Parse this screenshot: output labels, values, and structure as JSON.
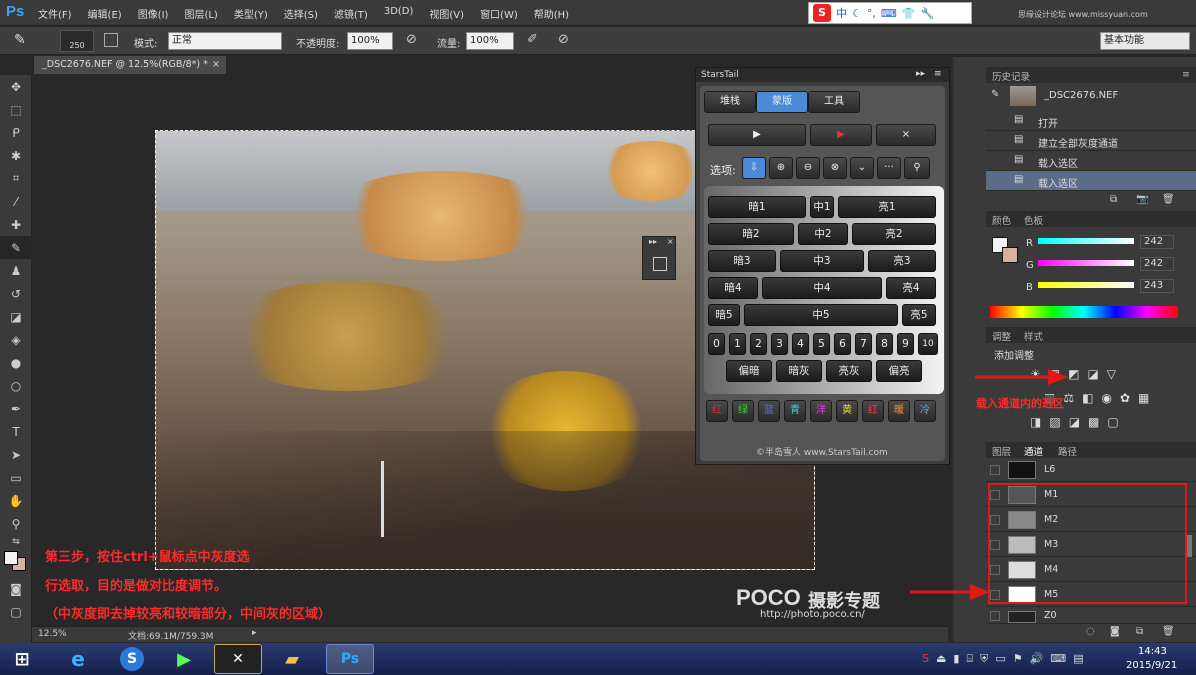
{
  "app": {
    "logo": "Ps",
    "workspace": "基本功能"
  },
  "menu": [
    "文件(F)",
    "编辑(E)",
    "图像(I)",
    "图层(L)",
    "类型(Y)",
    "选择(S)",
    "滤镜(T)",
    "3D(D)",
    "视图(V)",
    "窗口(W)",
    "帮助(H)"
  ],
  "ime": {
    "s": "S",
    "lang": "中"
  },
  "site_watermark": "思缘设计论坛 www.missyuan.com",
  "options": {
    "brush_size": "250",
    "mode_label": "模式:",
    "mode_value": "正常",
    "opacity_label": "不透明度:",
    "opacity_value": "100%",
    "flow_label": "流量:",
    "flow_value": "100%"
  },
  "document": {
    "tab": "_DSC2676.NEF @ 12.5%(RGB/8*) *",
    "zoom": "12.5%",
    "doc_info": "文档:69.1M/759.3M"
  },
  "starstail": {
    "title": "StarsTail",
    "tabs": [
      "堆栈",
      "蒙版",
      "工具"
    ],
    "options_label": "选项:",
    "rows": [
      [
        "暗1",
        "中1",
        "亮1"
      ],
      [
        "暗2",
        "中2",
        "亮2"
      ],
      [
        "暗3",
        "中3",
        "亮3"
      ],
      [
        "暗4",
        "中4",
        "亮4"
      ],
      [
        "暗5",
        "中5",
        "亮5"
      ]
    ],
    "numbers": [
      "0",
      "1",
      "2",
      "3",
      "4",
      "5",
      "6",
      "7",
      "8",
      "9",
      "10"
    ],
    "tones": [
      "偏暗",
      "暗灰",
      "亮灰",
      "偏亮"
    ],
    "colors": [
      {
        "label": "红",
        "color": "#d83030"
      },
      {
        "label": "绿",
        "color": "#3fcf3f"
      },
      {
        "label": "蓝",
        "color": "#5a6bff"
      },
      {
        "label": "青",
        "color": "#35d8d8"
      },
      {
        "label": "洋",
        "color": "#e040e0"
      },
      {
        "label": "黄",
        "color": "#e8e030"
      },
      {
        "label": "红",
        "color": "#ff3a3a"
      },
      {
        "label": "暖",
        "color": "#ff8a30"
      },
      {
        "label": "冷",
        "color": "#40b8ff"
      }
    ],
    "footer": "©半岛雪人 www.StarsTail.com"
  },
  "history": {
    "tab": "历史记录",
    "snapshot": "_DSC2676.NEF",
    "items": [
      "打开",
      "建立全部灰度通道",
      "载入选区",
      "载入选区"
    ]
  },
  "color_panel": {
    "tabs": [
      "颜色",
      "色板"
    ],
    "r_label": "R",
    "g_label": "G",
    "b_label": "B",
    "r": "242",
    "g": "242",
    "b": "243"
  },
  "adjust_panel": {
    "tabs": [
      "调整",
      "样式"
    ],
    "add": "添加调整",
    "annotation": "载入通道内的选区"
  },
  "channels": {
    "tabs": [
      "图层",
      "通道",
      "路径"
    ],
    "items": [
      "L6",
      "M1",
      "M2",
      "M3",
      "M4",
      "M5",
      "Z0"
    ]
  },
  "annotation": {
    "line1": "第三步，按住ctrl+鼠标点中灰度选",
    "line2": "行选取，目的是做对比度调节。",
    "line3": "（中灰度即去掉较亮和较暗部分，中间灰的区域）"
  },
  "poco": {
    "brand": "POCO",
    "title": "摄影专题",
    "url": "http://photo.poco.cn/"
  },
  "taskbar": {
    "time": "14:43",
    "date": "2015/9/21"
  }
}
